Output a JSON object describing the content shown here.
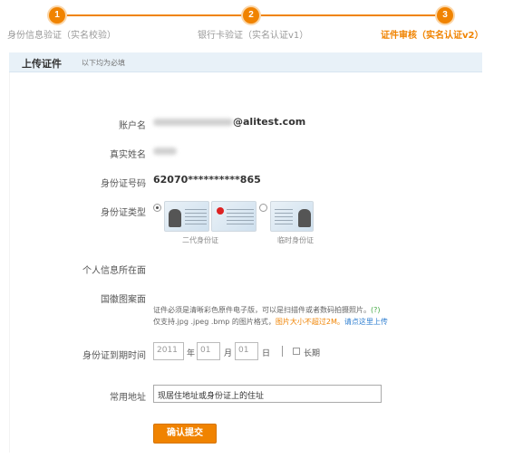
{
  "steps": [
    {
      "num": "1",
      "label": "身份信息验证（实名校验）"
    },
    {
      "num": "2",
      "label": "银行卡验证（实名认证v1）"
    },
    {
      "num": "3",
      "label": "证件审核（实名认证v2）"
    }
  ],
  "section": {
    "title": "上传证件",
    "subtitle": "以下均为必填"
  },
  "form": {
    "account_label": "账户名",
    "account_suffix": "@alitest.com",
    "realname_label": "真实姓名",
    "idnum_label": "身份证号码",
    "idnum_value": "62070**********865",
    "idtype_label": "身份证类型",
    "idtype_options": [
      "二代身份证",
      "临时身份证"
    ],
    "personal_page_label": "个人信息所在面",
    "emblem_page_label": "国徽图案面",
    "note_line1_a": "证件必须是清晰彩色原件电子版，可以是扫描件或者数码拍摄照片。",
    "note_line1_help": "(?)",
    "note_line2_a": "仅支持.jpg .jpeg .bmp 的图片格式，",
    "note_line2_size": "图片大小不超过2M。",
    "note_line2_link": "请点这里上传",
    "expiry_label": "身份证到期时间",
    "expiry_year": "2011",
    "expiry_year_unit": "年",
    "expiry_month": "01",
    "expiry_month_unit": "月",
    "expiry_day": "01",
    "expiry_day_unit": "日",
    "longterm_label": "长期",
    "address_label": "常用地址",
    "address_value": "现居住地址或身份证上的住址",
    "submit_label": "确认提交"
  },
  "colors": {
    "accent": "#f08300",
    "header_bg": "#e8f1f8",
    "link": "#2f7fd1"
  }
}
